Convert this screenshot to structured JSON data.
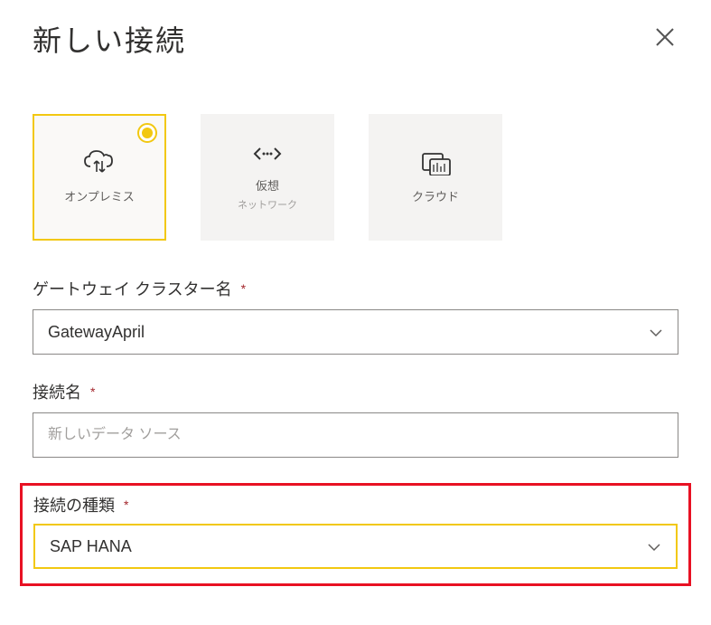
{
  "header": {
    "title": "新しい接続"
  },
  "tiles": [
    {
      "label": "オンプレミス",
      "sublabel": "",
      "selected": true
    },
    {
      "label": "仮想",
      "sublabel": "ネットワーク",
      "selected": false
    },
    {
      "label": "クラウド",
      "sublabel": "",
      "selected": false
    }
  ],
  "fields": {
    "gateway": {
      "label": "ゲートウェイ クラスター名",
      "required": "*",
      "value": "GatewayApril"
    },
    "connectionName": {
      "label": "接続名",
      "required": "*",
      "placeholder": "新しいデータ ソース"
    },
    "connectionType": {
      "label": "接続の種類",
      "required": "*",
      "value": "SAP HANA"
    }
  }
}
